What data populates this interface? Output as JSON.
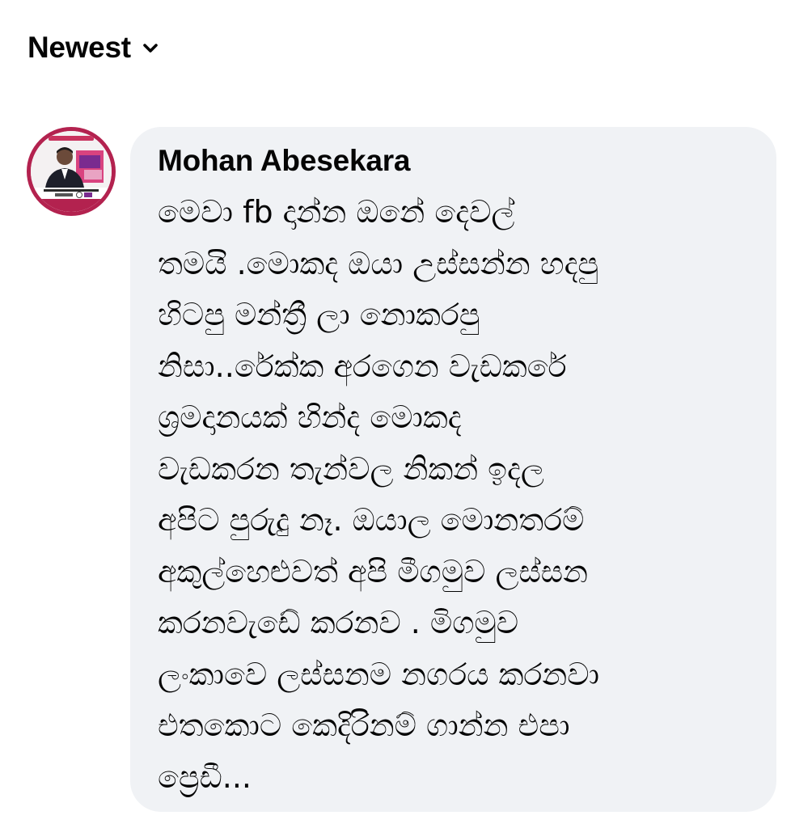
{
  "sort": {
    "label": "Newest"
  },
  "comment": {
    "author": "Mohan Abesekara",
    "lines": [
      "මෙවා fb දාන්න ඔනේ දෙවල්",
      "තමයි .මොකද ඔයා උස්සන්න හදපු",
      "හිටපු මන්ත්‍රී ලා නොකරපු",
      "නිසා..රේක්ක අරගෙන වැඩකරේ",
      "ශ්‍රමදානයක් හින්ද  මොකද",
      "වැඩකරන තැන්වල නිකන් ඉදල",
      "අපිට පුරුදු නෑ. ඔයාල මොනතරම්",
      "අකුල්හෙළුවත් අපි මීගමුව ලස්සන",
      "කරනවැඩේ කරනව . මිගමුව",
      "ලංකාවෙ ලස්සනම නගරය කරනවා",
      "එතකොට කෙදිරිනම් ගාන්න එපා",
      "ප්‍රෙඩී..."
    ]
  },
  "icons": {
    "sort_chevron": "chevron-down-icon",
    "avatar": "profile-photo"
  },
  "colors": {
    "bubble_background": "#f0f2f5",
    "avatar_ring": "#b3224f",
    "text": "#050505"
  }
}
